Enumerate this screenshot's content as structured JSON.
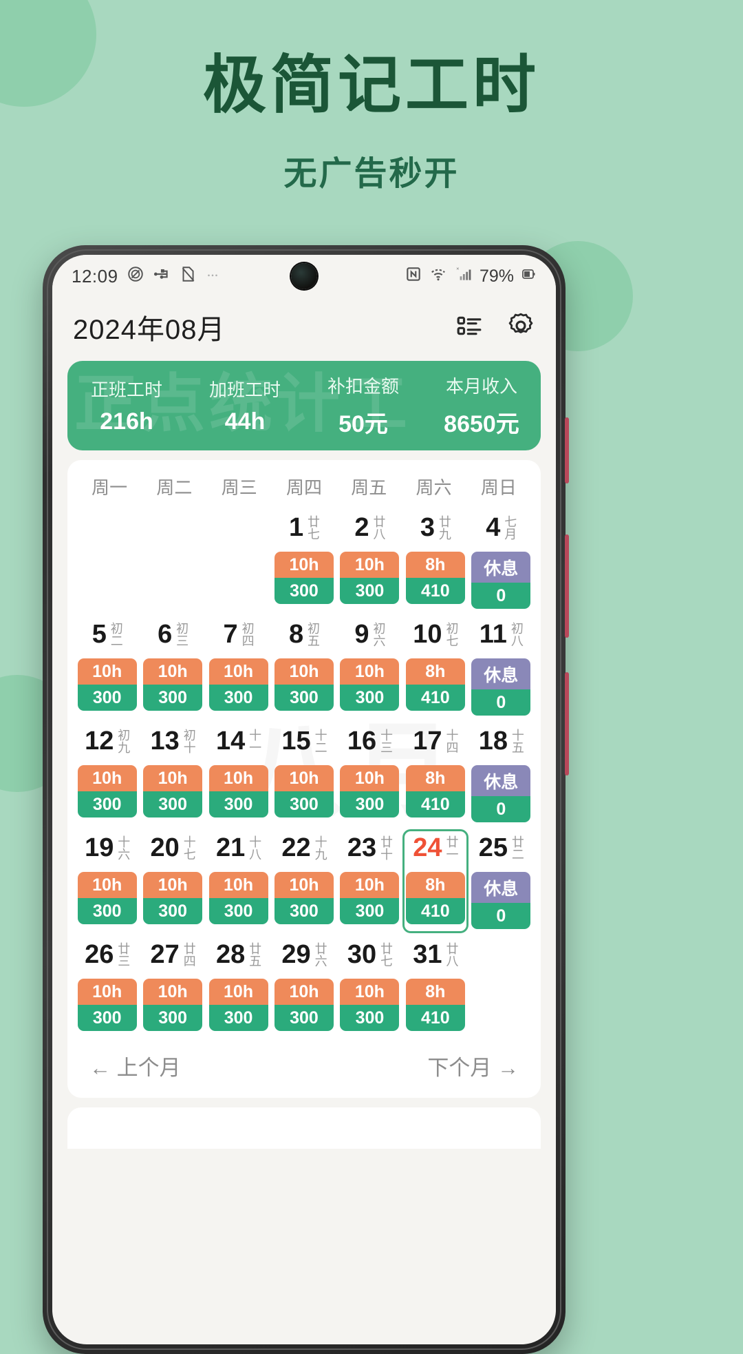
{
  "hero": {
    "title": "极简记工时",
    "subtitle": "无广告秒开"
  },
  "colors": {
    "page_bg": "#a8d8bf",
    "hero_title": "#1b5637",
    "accent_green": "#45b07f",
    "badge_orange": "#ef8a5a",
    "badge_green": "#2bab7c",
    "badge_rest": "#8a88b8",
    "selected_red": "#ef5136"
  },
  "statusbar": {
    "time": "12:09",
    "battery": "79%",
    "left_icons": [
      "mute-icon",
      "usb-icon",
      "document-icon",
      "more-icon"
    ],
    "right_icons": [
      "nfc-icon",
      "wifi-icon",
      "signal-icon",
      "battery-icon"
    ]
  },
  "appbar": {
    "title": "2024年08月",
    "actions": [
      {
        "name": "list-view-icon",
        "label": "列表"
      },
      {
        "name": "gear-icon",
        "label": "设置"
      }
    ]
  },
  "watermark": "正点统计工",
  "calendar_watermark": "八月",
  "summary": [
    {
      "label": "正班工时",
      "value": "216h"
    },
    {
      "label": "加班工时",
      "value": "44h"
    },
    {
      "label": "补扣金额",
      "value": "50元"
    },
    {
      "label": "本月收入",
      "value": "8650元"
    }
  ],
  "weekdays": [
    "周一",
    "周二",
    "周三",
    "周四",
    "周五",
    "周六",
    "周日"
  ],
  "month_nav": {
    "prev": "← 上个月",
    "next": "下个月 →"
  },
  "days": [
    {
      "empty": true
    },
    {
      "empty": true
    },
    {
      "empty": true
    },
    {
      "day": "1",
      "lunar": "廿七",
      "hours": "10h",
      "amount": "300",
      "type": "work"
    },
    {
      "day": "2",
      "lunar": "廿八",
      "hours": "10h",
      "amount": "300",
      "type": "work"
    },
    {
      "day": "3",
      "lunar": "廿九",
      "hours": "8h",
      "amount": "410",
      "type": "work"
    },
    {
      "day": "4",
      "lunar": "七月",
      "hours": "休息",
      "amount": "0",
      "type": "rest"
    },
    {
      "day": "5",
      "lunar": "初二",
      "hours": "10h",
      "amount": "300",
      "type": "work"
    },
    {
      "day": "6",
      "lunar": "初三",
      "hours": "10h",
      "amount": "300",
      "type": "work"
    },
    {
      "day": "7",
      "lunar": "初四",
      "hours": "10h",
      "amount": "300",
      "type": "work"
    },
    {
      "day": "8",
      "lunar": "初五",
      "hours": "10h",
      "amount": "300",
      "type": "work"
    },
    {
      "day": "9",
      "lunar": "初六",
      "hours": "10h",
      "amount": "300",
      "type": "work"
    },
    {
      "day": "10",
      "lunar": "初七",
      "hours": "8h",
      "amount": "410",
      "type": "work"
    },
    {
      "day": "11",
      "lunar": "初八",
      "hours": "休息",
      "amount": "0",
      "type": "rest"
    },
    {
      "day": "12",
      "lunar": "初九",
      "hours": "10h",
      "amount": "300",
      "type": "work"
    },
    {
      "day": "13",
      "lunar": "初十",
      "hours": "10h",
      "amount": "300",
      "type": "work"
    },
    {
      "day": "14",
      "lunar": "十一",
      "hours": "10h",
      "amount": "300",
      "type": "work"
    },
    {
      "day": "15",
      "lunar": "十二",
      "hours": "10h",
      "amount": "300",
      "type": "work"
    },
    {
      "day": "16",
      "lunar": "十三",
      "hours": "10h",
      "amount": "300",
      "type": "work"
    },
    {
      "day": "17",
      "lunar": "十四",
      "hours": "8h",
      "amount": "410",
      "type": "work"
    },
    {
      "day": "18",
      "lunar": "十五",
      "hours": "休息",
      "amount": "0",
      "type": "rest"
    },
    {
      "day": "19",
      "lunar": "十六",
      "hours": "10h",
      "amount": "300",
      "type": "work"
    },
    {
      "day": "20",
      "lunar": "十七",
      "hours": "10h",
      "amount": "300",
      "type": "work"
    },
    {
      "day": "21",
      "lunar": "十八",
      "hours": "10h",
      "amount": "300",
      "type": "work"
    },
    {
      "day": "22",
      "lunar": "十九",
      "hours": "10h",
      "amount": "300",
      "type": "work"
    },
    {
      "day": "23",
      "lunar": "廿十",
      "hours": "10h",
      "amount": "300",
      "type": "work"
    },
    {
      "day": "24",
      "lunar": "廿一",
      "hours": "8h",
      "amount": "410",
      "type": "work",
      "selected": true
    },
    {
      "day": "25",
      "lunar": "廿二",
      "hours": "休息",
      "amount": "0",
      "type": "rest"
    },
    {
      "day": "26",
      "lunar": "廿三",
      "hours": "10h",
      "amount": "300",
      "type": "work"
    },
    {
      "day": "27",
      "lunar": "廿四",
      "hours": "10h",
      "amount": "300",
      "type": "work"
    },
    {
      "day": "28",
      "lunar": "廿五",
      "hours": "10h",
      "amount": "300",
      "type": "work"
    },
    {
      "day": "29",
      "lunar": "廿六",
      "hours": "10h",
      "amount": "300",
      "type": "work"
    },
    {
      "day": "30",
      "lunar": "廿七",
      "hours": "10h",
      "amount": "300",
      "type": "work"
    },
    {
      "day": "31",
      "lunar": "廿八",
      "hours": "8h",
      "amount": "410",
      "type": "work"
    },
    {
      "empty": true
    }
  ]
}
